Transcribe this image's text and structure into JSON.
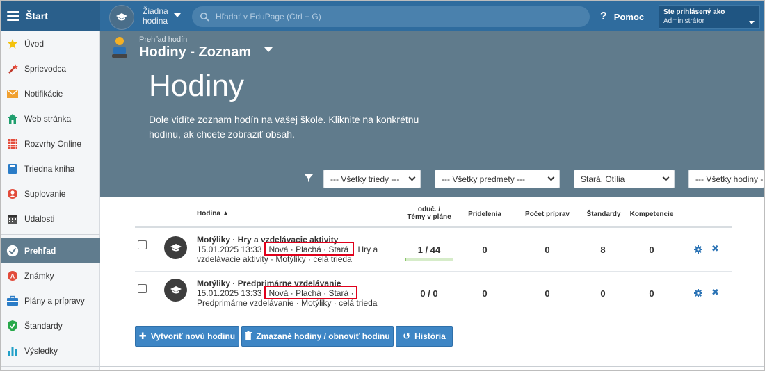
{
  "topbar": {
    "start_label": "Štart",
    "lesson_line1": "Žiadna",
    "lesson_line2": "hodina",
    "search_placeholder": "Hľadať v EduPage (Ctrl + G)",
    "help_label": "Pomoc",
    "user_line1": "Ste prihlásený ako",
    "user_line2": "Administrátor"
  },
  "sidebar": {
    "items": [
      {
        "label": "Úvod",
        "icon": "star-icon"
      },
      {
        "label": "Sprievodca",
        "icon": "wand-icon"
      },
      {
        "label": "Notifikácie",
        "icon": "envelope-icon"
      },
      {
        "label": "Web stránka",
        "icon": "house-icon"
      },
      {
        "label": "Rozvrhy Online",
        "icon": "timetable-icon"
      },
      {
        "label": "Triedna kniha",
        "icon": "book-icon"
      },
      {
        "label": "Suplovanie",
        "icon": "substitute-icon"
      },
      {
        "label": "Udalosti",
        "icon": "calendar-icon"
      },
      {
        "label": "Prehľad",
        "icon": "check-icon"
      },
      {
        "label": "Známky",
        "icon": "grades-icon"
      },
      {
        "label": "Plány a prípravy",
        "icon": "briefcase-icon"
      },
      {
        "label": "Štandardy",
        "icon": "shield-check-icon"
      },
      {
        "label": "Výsledky",
        "icon": "bar-chart-icon"
      }
    ]
  },
  "hero": {
    "breadcrumb": "Prehľad hodín",
    "title": "Hodiny - Zoznam",
    "big_title": "Hodiny",
    "description": "Dole vidíte zoznam hodín na vašej škole. Kliknite na konkrétnu hodinu, ak chcete zobraziť obsah.",
    "filters": [
      "--- Všetky triedy ---",
      "--- Všetky predmety ---",
      "Stará, Otília",
      "--- Všetky hodiny -"
    ]
  },
  "table": {
    "headers": {
      "hodina": "Hodina ▲",
      "oduc_1": "oduč. /",
      "oduc_2": "Témy v pláne",
      "pridelenia": "Pridelenia",
      "pocet": "Počet príprav",
      "standardy": "Štandardy",
      "kompetencie": "Kompetencie"
    },
    "rows": [
      {
        "title": "Motýliky · Hry a vzdelávacie aktivity",
        "datetime": "15.01.2025 13:33",
        "teachers": "Nová · Plachá · Stará",
        "meta_tail_1": "Hry a",
        "meta_line2": "vzdelávacie aktivity · Motýliky · celá trieda",
        "oduc": "1 / 44",
        "progress": 0.023,
        "pridelenia": "0",
        "pocet": "0",
        "standardy": "8",
        "kompetencie": "0"
      },
      {
        "title": "Motýliky · Predprimárne vzdelávanie",
        "datetime": "15.01.2025 13:33",
        "teachers": "Nová · Plachá · Stará ·",
        "meta_tail_1": "",
        "meta_line2": "Predprimárne vzdelávanie · Motýliky · celá trieda",
        "oduc": "0 / 0",
        "pridelenia": "0",
        "pocet": "0",
        "standardy": "0",
        "kompetencie": "0"
      }
    ]
  },
  "buttons": {
    "create": "Vytvoriť novú hodinu",
    "deleted": "Zmazané hodiny / obnoviť hodinu",
    "history": "História"
  },
  "colors": {
    "topbar": "#2f6c9e",
    "hero": "#607b8c",
    "accent": "#3e86c5",
    "highlight": "#e0001b"
  }
}
